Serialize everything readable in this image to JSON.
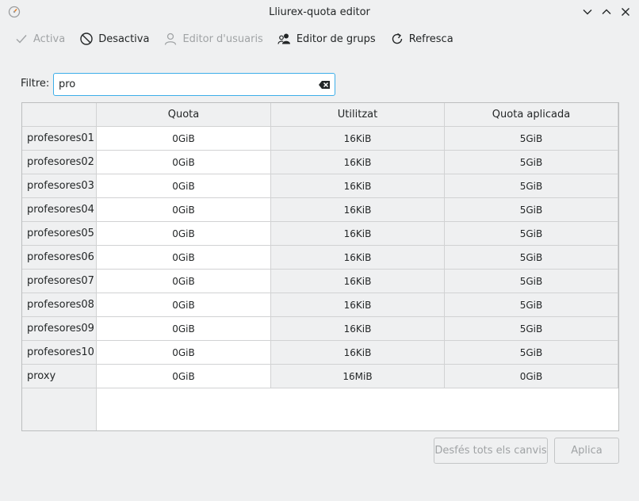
{
  "window": {
    "title": "Lliurex-quota editor"
  },
  "toolbar": {
    "activate_label": "Activa",
    "deactivate_label": "Desactiva",
    "user_editor_label": "Editor d'usuaris",
    "group_editor_label": "Editor de grups",
    "refresh_label": "Refresca"
  },
  "filter": {
    "label": "Filtre:",
    "value": "pro"
  },
  "table": {
    "headers": [
      "Quota",
      "Utilitzat",
      "Quota aplicada"
    ],
    "rows": [
      {
        "name": "profesores01",
        "quota": "0GiB",
        "used": "16KiB",
        "applied": "5GiB"
      },
      {
        "name": "profesores02",
        "quota": "0GiB",
        "used": "16KiB",
        "applied": "5GiB"
      },
      {
        "name": "profesores03",
        "quota": "0GiB",
        "used": "16KiB",
        "applied": "5GiB"
      },
      {
        "name": "profesores04",
        "quota": "0GiB",
        "used": "16KiB",
        "applied": "5GiB"
      },
      {
        "name": "profesores05",
        "quota": "0GiB",
        "used": "16KiB",
        "applied": "5GiB"
      },
      {
        "name": "profesores06",
        "quota": "0GiB",
        "used": "16KiB",
        "applied": "5GiB"
      },
      {
        "name": "profesores07",
        "quota": "0GiB",
        "used": "16KiB",
        "applied": "5GiB"
      },
      {
        "name": "profesores08",
        "quota": "0GiB",
        "used": "16KiB",
        "applied": "5GiB"
      },
      {
        "name": "profesores09",
        "quota": "0GiB",
        "used": "16KiB",
        "applied": "5GiB"
      },
      {
        "name": "profesores10",
        "quota": "0GiB",
        "used": "16KiB",
        "applied": "5GiB"
      },
      {
        "name": "proxy",
        "quota": "0GiB",
        "used": "16MiB",
        "applied": "0GiB"
      }
    ]
  },
  "buttons": {
    "undo_all_label": "Desfés tots els canvis",
    "apply_label": "Aplica"
  }
}
